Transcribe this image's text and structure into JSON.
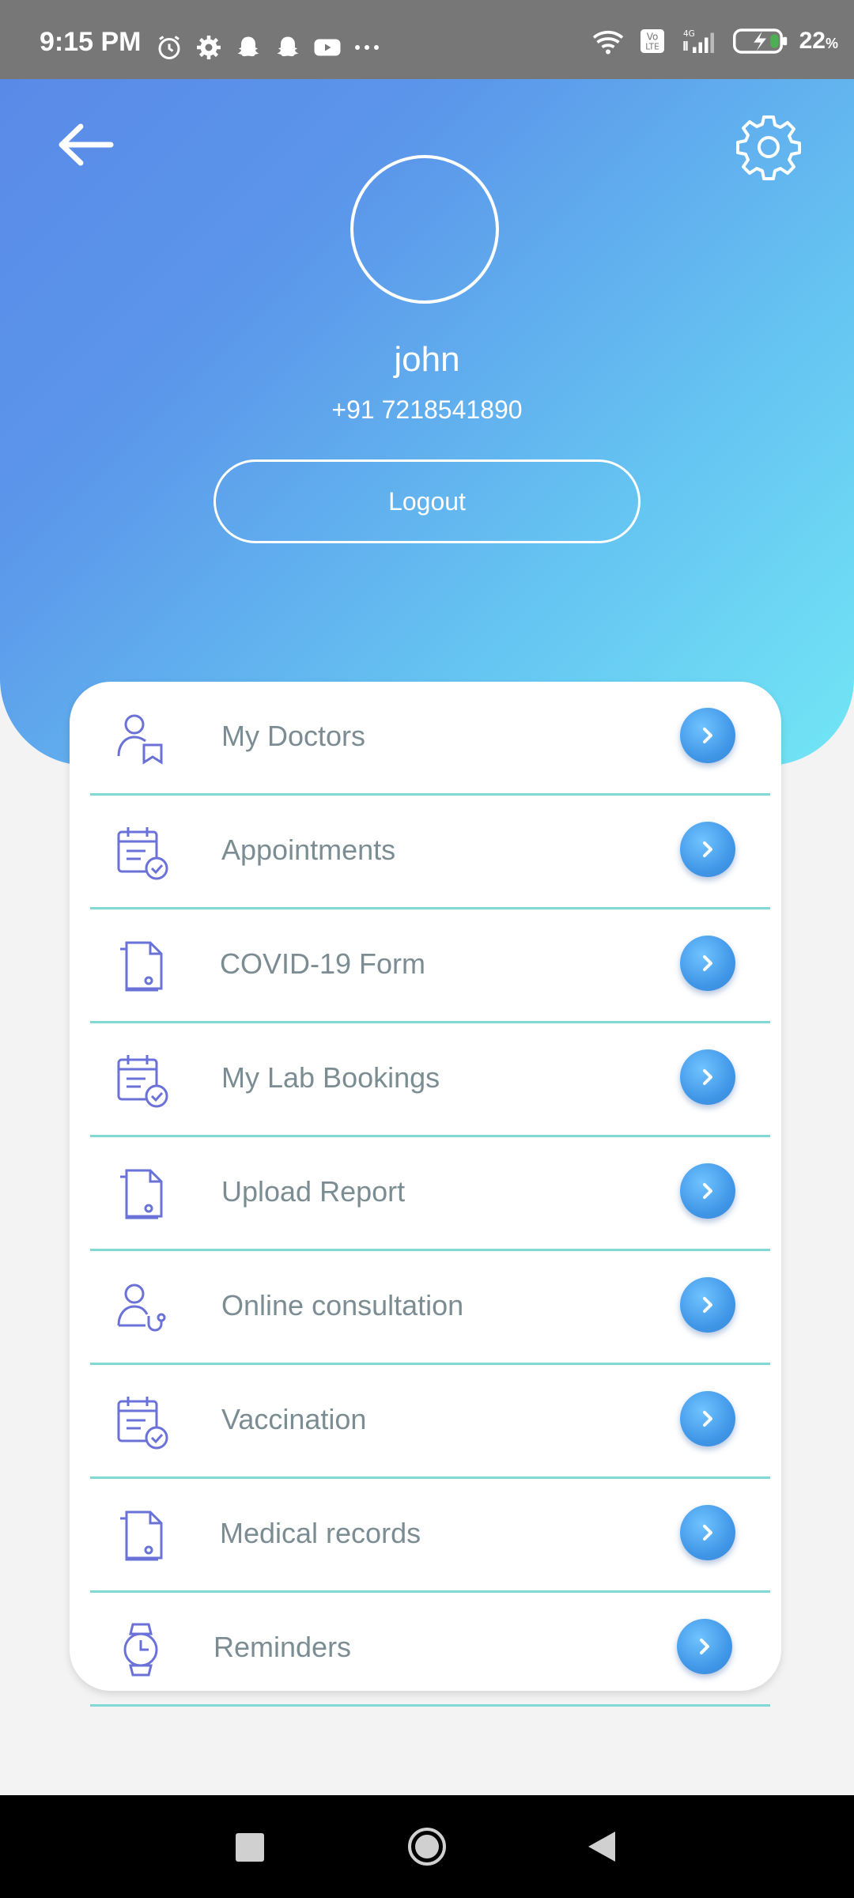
{
  "status_bar": {
    "time": "9:15 PM",
    "battery": "22",
    "battery_unit": "%",
    "left_icons": [
      "alarm-icon",
      "gear-icon",
      "snapchat-icon",
      "snapchat-icon",
      "youtube-icon",
      "more-dots-icon"
    ],
    "right_icons": [
      "wifi-icon",
      "volte-icon",
      "signal-4g-icon",
      "battery-charging-icon"
    ],
    "network_label": "4G",
    "volte_label": "Vo LTE"
  },
  "header": {
    "back_icon": "arrow-left-icon",
    "settings_icon": "gear-icon",
    "name": "john",
    "phone": "+91 7218541890",
    "logout_label": "Logout"
  },
  "menu": {
    "items": [
      {
        "label": "My Doctors",
        "icon": "doctor-icon"
      },
      {
        "label": "Appointments",
        "icon": "calendar-check-icon"
      },
      {
        "label": "COVID-19 Form",
        "icon": "document-icon"
      },
      {
        "label": "My Lab Bookings",
        "icon": "calendar-check-icon"
      },
      {
        "label": "Upload Report",
        "icon": "document-icon"
      },
      {
        "label": "Online consultation",
        "icon": "consultation-icon"
      },
      {
        "label": "Vaccination",
        "icon": "calendar-check-icon"
      },
      {
        "label": "Medical records",
        "icon": "document-icon"
      },
      {
        "label": "Reminders",
        "icon": "watch-icon"
      }
    ]
  },
  "colors": {
    "gradient_start": "#5a8ae8",
    "gradient_end": "#72e6f5",
    "icon_color": "#6a72d8",
    "divider": "#7fdad6",
    "label_text": "#7b8d93",
    "arrow_button": "#3f95e6"
  }
}
